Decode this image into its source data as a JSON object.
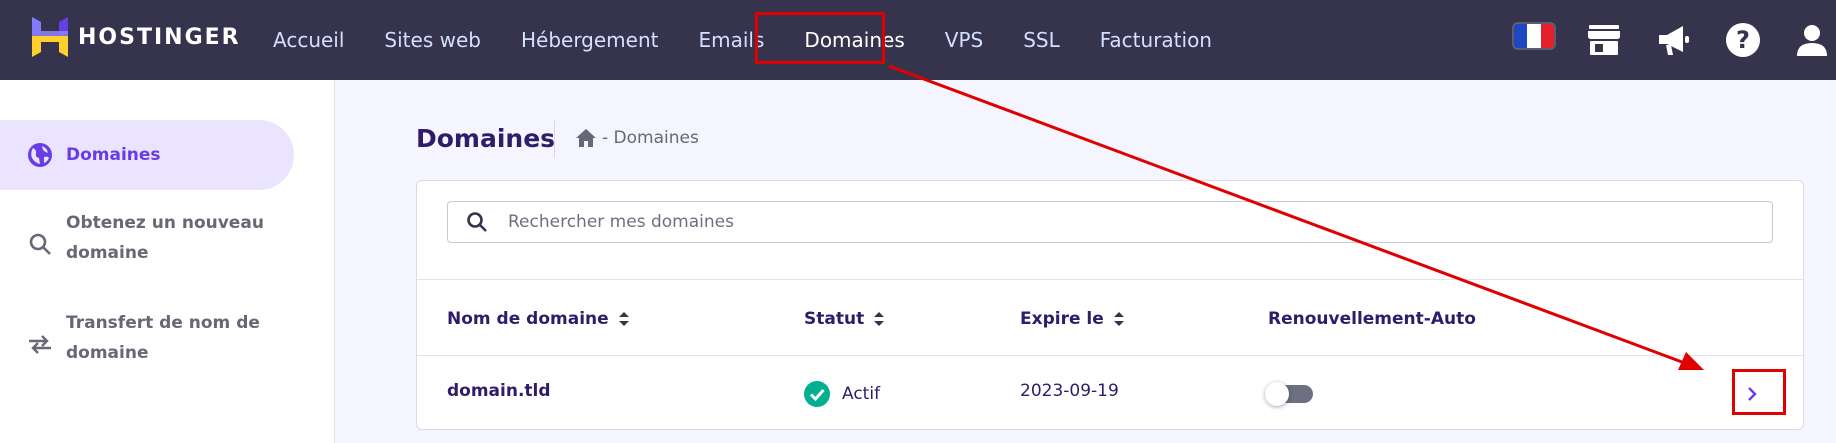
{
  "brand": {
    "name": "HOSTINGER"
  },
  "nav": {
    "items": [
      {
        "label": "Accueil"
      },
      {
        "label": "Sites web"
      },
      {
        "label": "Hébergement"
      },
      {
        "label": "Emails"
      },
      {
        "label": "Domaines"
      },
      {
        "label": "VPS"
      },
      {
        "label": "SSL"
      },
      {
        "label": "Facturation"
      }
    ]
  },
  "topbar_icons": [
    "france-flag-icon",
    "store-icon",
    "megaphone-icon",
    "help-icon",
    "user-icon"
  ],
  "sidebar": {
    "items": [
      {
        "label": "Domaines",
        "icon": "globe-icon"
      },
      {
        "label_line1": "Obtenez un nouveau",
        "label_line2": "domaine",
        "icon": "search-icon"
      },
      {
        "label_line1": "Transfert de nom de",
        "label_line2": "domaine",
        "icon": "transfer-icon"
      }
    ]
  },
  "page": {
    "title": "Domaines",
    "breadcrumb": "- Domaines"
  },
  "search": {
    "placeholder": "Rechercher mes domaines"
  },
  "table": {
    "headers": {
      "domain": "Nom de domaine",
      "status": "Statut",
      "expires": "Expire le",
      "autorenew": "Renouvellement-Auto"
    },
    "rows": [
      {
        "domain": "domain.tld",
        "status": "Actif",
        "expires": "2023-09-19",
        "autorenew": false
      }
    ]
  },
  "colors": {
    "topbar": "#36344d",
    "accent": "#673de6",
    "highlight": "#e00000",
    "status_ok": "#00b090"
  }
}
